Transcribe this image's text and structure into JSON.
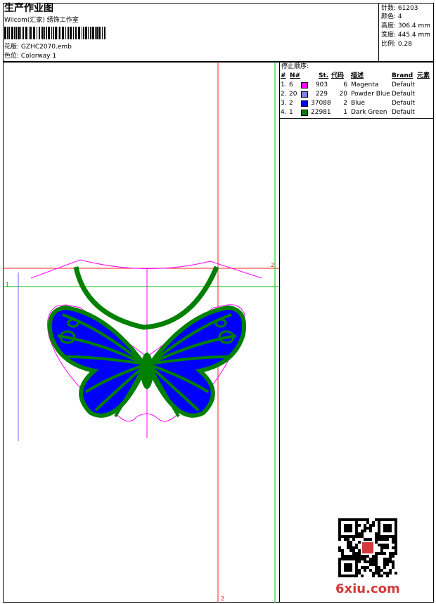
{
  "header": {
    "title": "生产作业图",
    "studio": "Wilcom(汇家) 绣饰工作室",
    "design_label": "花版:",
    "design_name": "GZHC2070.emb",
    "colorway_label": "色位:",
    "colorway_name": "Colorway 1"
  },
  "stats": {
    "stitches": "针数: 61203",
    "colors": "颜色: 4",
    "height": "高度: 306.4 mm",
    "width": "宽度: 445.4 mm",
    "scale": "比例: 0.28"
  },
  "stop_sequence": {
    "heading": "停止顺序:",
    "columns": {
      "num": "#",
      "needle": "N#",
      "stitches": "St.",
      "code": "代码",
      "desc": "描述",
      "brand": "Brand",
      "element": "元素"
    },
    "rows": [
      {
        "num": "1.",
        "needle": "6",
        "color": "#ff00ff",
        "stitches": "903",
        "code": "6",
        "desc": "Magenta",
        "brand": "Default"
      },
      {
        "num": "2.",
        "needle": "20",
        "color": "#7f7fff",
        "stitches": "229",
        "code": "20",
        "desc": "Powder Blue",
        "brand": "Default"
      },
      {
        "num": "3.",
        "needle": "2",
        "color": "#0000ff",
        "stitches": "37088",
        "code": "2",
        "desc": "Blue",
        "brand": "Default"
      },
      {
        "num": "4.",
        "needle": "1",
        "color": "#008000",
        "stitches": "22981",
        "code": "1",
        "desc": "Dark Green",
        "brand": "Default"
      }
    ]
  },
  "guides": {
    "h_marker": "1",
    "v_marker_top": "2",
    "v_marker_bottom": "2"
  },
  "colors": {
    "magenta": "#ff00ff",
    "blue": "#0000ff",
    "green": "#008000",
    "red_guide": "#ff0000",
    "green_guide": "#00c000",
    "blue_guide": "#6060ff"
  },
  "watermark": "6xiu.com"
}
